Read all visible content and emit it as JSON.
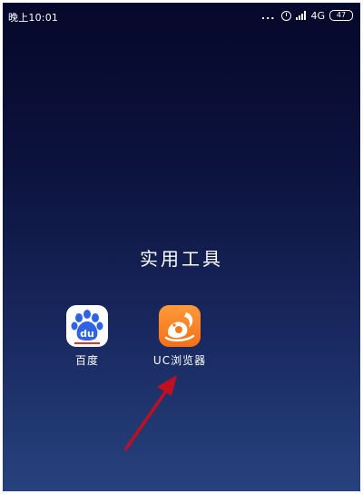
{
  "status_bar": {
    "time": "晚上10:01",
    "dots": "...",
    "network": "4G",
    "battery": "47"
  },
  "folder": {
    "title": "实用工具",
    "apps": [
      {
        "label": "百度",
        "icon_text": "du",
        "icon": "baidu-icon"
      },
      {
        "label": "UC浏览器",
        "icon": "uc-squirrel-icon"
      }
    ]
  },
  "colors": {
    "arrow": "#c01020",
    "uc_orange": "#f47a1e",
    "baidu_blue": "#2e63e4"
  }
}
